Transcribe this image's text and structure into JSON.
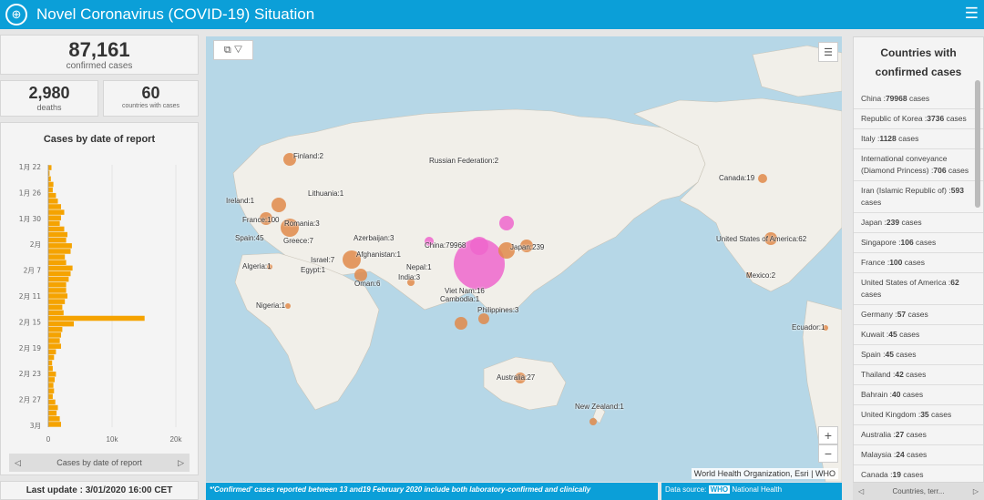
{
  "header": {
    "title": "Novel Coronavirus (COVID-19) Situation"
  },
  "summary": {
    "confirmed": {
      "value": "87,161",
      "label": "confirmed cases"
    },
    "deaths": {
      "value": "2,980",
      "label": "deaths"
    },
    "countries": {
      "value": "60",
      "label": "countries with cases"
    }
  },
  "chart_panel": {
    "title": "Cases by date of report",
    "nav_label": "Cases by date of report"
  },
  "chart_data": {
    "type": "bar",
    "orientation": "horizontal",
    "title": "Cases by date of report",
    "xlim": [
      0,
      20000
    ],
    "x_ticks": [
      "0",
      "10k",
      "20k"
    ],
    "y_ticks": [
      "1月 22",
      "1月 26",
      "1月 30",
      "2月",
      "2月 7",
      "2月 11",
      "2月 15",
      "2月 19",
      "2月 23",
      "2月 27",
      "3月"
    ],
    "values": [
      500,
      200,
      400,
      800,
      700,
      1200,
      1500,
      2000,
      2500,
      2000,
      1800,
      2500,
      3000,
      2800,
      3700,
      3500,
      2600,
      2800,
      3800,
      3500,
      3200,
      2800,
      2800,
      3000,
      2600,
      2200,
      2400,
      15100,
      4000,
      2200,
      2000,
      1800,
      2000,
      1200,
      900,
      600,
      700,
      1200,
      1000,
      800,
      900,
      700,
      1100,
      1500,
      1300,
      1800,
      2000
    ]
  },
  "last_update": "Last update : 3/01/2020 16:00 CET",
  "map": {
    "attribution": "World Health Organization, Esri | WHO",
    "zoom_in": "+",
    "zoom_out": "−",
    "labels": [
      {
        "text": "Russian Federation:2"
      },
      {
        "text": "Finland:2"
      },
      {
        "text": "Lithuania:1"
      },
      {
        "text": "Ireland:1"
      },
      {
        "text": "France:100"
      },
      {
        "text": "Romania:3"
      },
      {
        "text": "Spain:45"
      },
      {
        "text": "Greece:7"
      },
      {
        "text": "Azerbaijan:3"
      },
      {
        "text": "Algeria:1"
      },
      {
        "text": "Israel:7"
      },
      {
        "text": "Egypt:1"
      },
      {
        "text": "Afghanistan:1"
      },
      {
        "text": "Nepal:1"
      },
      {
        "text": "India:3"
      },
      {
        "text": "Oman:6"
      },
      {
        "text": "China:79968"
      },
      {
        "text": "Japan:239"
      },
      {
        "text": "Nigeria:1"
      },
      {
        "text": "Viet Nam:16"
      },
      {
        "text": "Cambodia:1"
      },
      {
        "text": "Philippines:3"
      },
      {
        "text": "Australia:27"
      },
      {
        "text": "New Zealand:1"
      },
      {
        "text": "Canada:19"
      },
      {
        "text": "United States of America:62"
      },
      {
        "text": "Mexico:2"
      },
      {
        "text": "Ecuador:1"
      }
    ]
  },
  "footnote": "*'Confirmed' cases reported between 13 and19 February 2020 include both laboratory-confirmed and clinically",
  "data_source": {
    "label": "Data source:",
    "who": "WHO",
    "rest": "National Health"
  },
  "country_list": {
    "title_line1": "Countries with",
    "title_line2": "confirmed cases",
    "items": [
      {
        "name": "China",
        "count": "79968"
      },
      {
        "name": "Republic of Korea",
        "count": "3736"
      },
      {
        "name": "Italy",
        "count": "1128"
      },
      {
        "name": "International conveyance (Diamond Princess)",
        "count": "706"
      },
      {
        "name": "Iran (Islamic Republic of)",
        "count": "593"
      },
      {
        "name": "Japan",
        "count": "239"
      },
      {
        "name": "Singapore",
        "count": "106"
      },
      {
        "name": "France",
        "count": "100"
      },
      {
        "name": "United States of America",
        "count": "62"
      },
      {
        "name": "Germany",
        "count": "57"
      },
      {
        "name": "Kuwait",
        "count": "45"
      },
      {
        "name": "Spain",
        "count": "45"
      },
      {
        "name": "Thailand",
        "count": "42"
      },
      {
        "name": "Bahrain",
        "count": "40"
      },
      {
        "name": "United Kingdom",
        "count": "35"
      },
      {
        "name": "Australia",
        "count": "27"
      },
      {
        "name": "Malaysia",
        "count": "24"
      },
      {
        "name": "Canada",
        "count": "19"
      }
    ],
    "unit": "cases",
    "nav_label": "Countries, terr..."
  },
  "colors": {
    "accent": "#0b9fd8",
    "bar": "#f5a300",
    "bubble": "#e08a4a",
    "china_bubble": "#ee66cc"
  }
}
